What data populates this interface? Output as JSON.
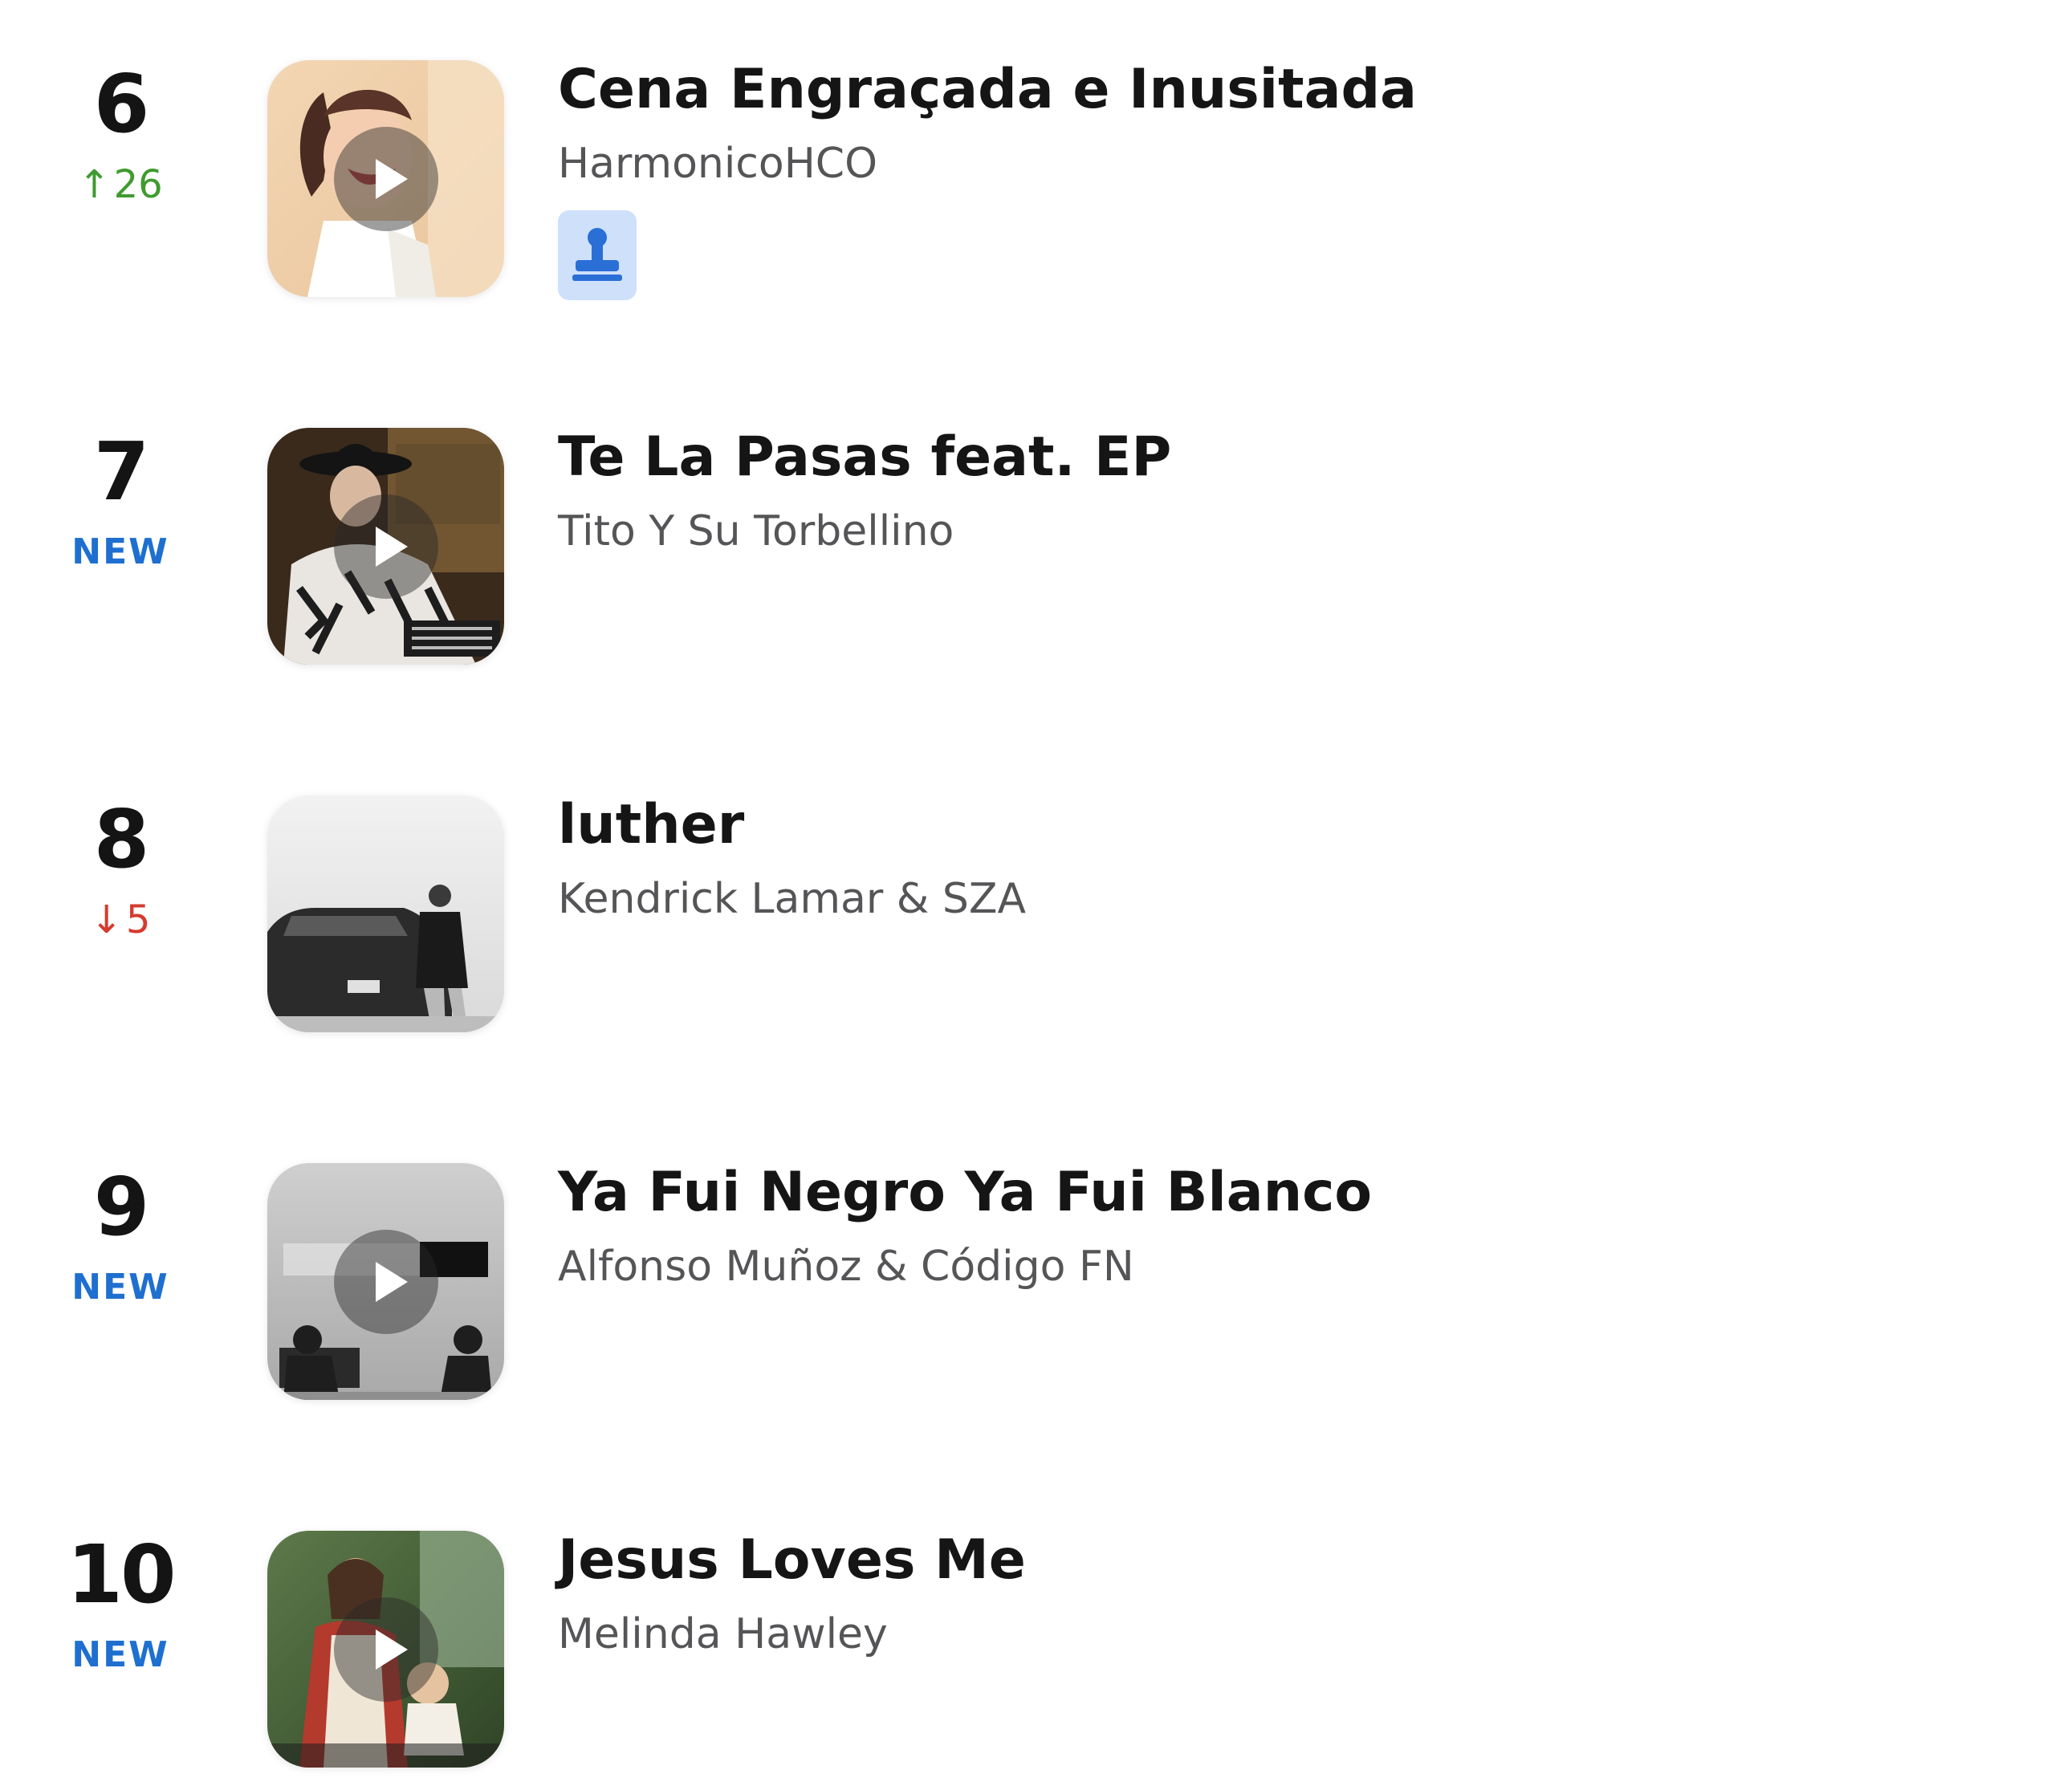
{
  "chart": {
    "entries": [
      {
        "rank": "6",
        "movement": {
          "type": "up",
          "arrow": "↑",
          "value": "26"
        },
        "title": "Cena Engraçada e Inusitada",
        "artist": "HarmonicoHCO",
        "artwork_icon": "cartoon-girl-laughing-artwork",
        "has_badge": true,
        "badge_icon": "stamp-icon"
      },
      {
        "rank": "7",
        "movement": {
          "type": "new",
          "value": "NEW"
        },
        "title": "Te La Pasas feat. EP",
        "artist": "Tito Y Su Torbellino",
        "artwork_icon": "cowboy-hat-man-artwork"
      },
      {
        "rank": "8",
        "movement": {
          "type": "down",
          "arrow": "↓",
          "value": "5"
        },
        "title": "luther",
        "artist": "Kendrick Lamar & SZA",
        "artwork_icon": "man-by-car-bw-artwork"
      },
      {
        "rank": "9",
        "movement": {
          "type": "new",
          "value": "NEW"
        },
        "title": "Ya Fui Negro Ya Fui Blanco",
        "artist": "Alfonso Muñoz & Código FN",
        "artwork_icon": "two-men-seated-bw-artwork"
      },
      {
        "rank": "10",
        "movement": {
          "type": "new",
          "value": "NEW"
        },
        "title": "Jesus Loves Me",
        "artist": "Melinda Hawley",
        "artwork_icon": "jesus-painting-artwork"
      }
    ]
  },
  "colors": {
    "up": "#3f9b2f",
    "down": "#d43b2e",
    "new": "#1e6fd0",
    "badge_bg": "#cfe0fb",
    "badge_icon": "#2a6fd6"
  }
}
